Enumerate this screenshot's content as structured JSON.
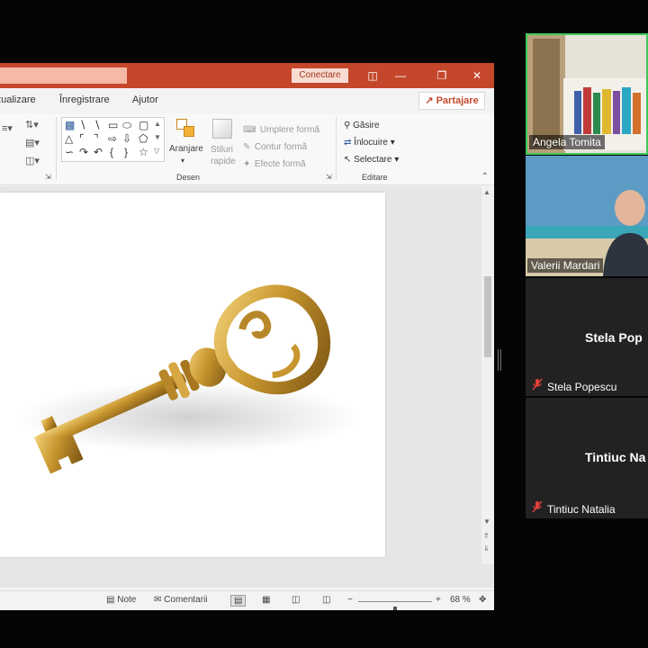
{
  "powerpoint": {
    "connect_label": "Conectare",
    "tabs": [
      "Vizualizare",
      "Înregistrare",
      "Ajutor"
    ],
    "share_label": "Partajare",
    "ribbon": {
      "arrange_label": "Aranjare",
      "quick_styles_label": "Stiluri rapide",
      "shape_fill_label": "Umplere formă",
      "shape_outline_label": "Contur formă",
      "shape_effects_label": "Efecte formă",
      "drawing_group_label": "Desen",
      "find_label": "Găsire",
      "replace_label": "Înlocuire",
      "select_label": "Selectare",
      "editing_group_label": "Editare"
    },
    "status": {
      "notes_label": "Note",
      "comments_label": "Comentarii",
      "zoom_label": "68 %",
      "zoom_fraction": 0.5
    }
  },
  "participants": [
    {
      "name": "Angela Tomita",
      "video": true,
      "muted": false,
      "active_speaker": true
    },
    {
      "name": "Valerii Mardari",
      "video": true,
      "muted": false,
      "active_speaker": false
    },
    {
      "name": "Stela Popescu",
      "display": "Stela Pop",
      "video": false,
      "muted": true
    },
    {
      "name": "Tintiuc Natalia",
      "display": "Tintiuc Na",
      "video": false,
      "muted": true
    }
  ],
  "colors": {
    "titlebar": "#c4472b",
    "active_speaker_border": "#3ec95a",
    "muted_icon": "#e0403a"
  }
}
